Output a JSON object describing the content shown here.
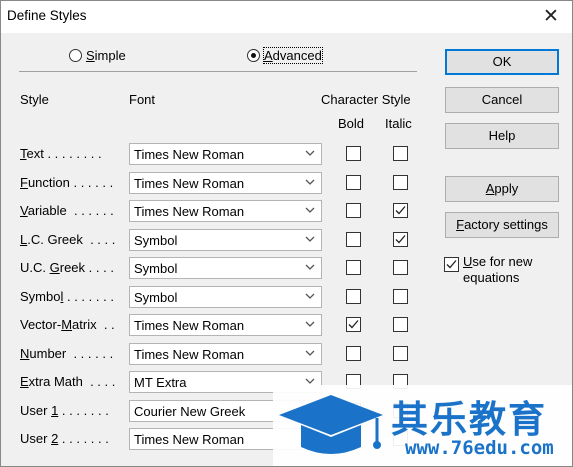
{
  "window": {
    "title": "Define Styles",
    "close_glyph": "✕"
  },
  "mode": {
    "simple_prefix": "",
    "simple_ul": "S",
    "simple_rest": "imple",
    "advanced_prefix": "",
    "advanced_ul": "A",
    "advanced_rest": "dvanced",
    "selected": "Advanced"
  },
  "headers": {
    "style": "Style",
    "font": "Font",
    "character_style": "Character Style",
    "bold": "Bold",
    "italic": "Italic"
  },
  "rows": [
    {
      "pre": "",
      "ul": "T",
      "post": "ext . . . . . . . .",
      "font": "Times New Roman",
      "bold": false,
      "italic": false
    },
    {
      "pre": "",
      "ul": "F",
      "post": "unction . . . . . .",
      "font": "Times New Roman",
      "bold": false,
      "italic": false
    },
    {
      "pre": "",
      "ul": "V",
      "post": "ariable  . . . . . .",
      "font": "Times New Roman",
      "bold": false,
      "italic": true
    },
    {
      "pre": "",
      "ul": "L",
      "post": ".C. Greek  . . . .",
      "font": "Symbol",
      "bold": false,
      "italic": true
    },
    {
      "pre": "U.C. ",
      "ul": "G",
      "post": "reek . . . .",
      "font": "Symbol",
      "bold": false,
      "italic": false
    },
    {
      "pre": "Symbo",
      "ul": "l",
      "post": " . . . . . . .",
      "font": "Symbol",
      "bold": false,
      "italic": false
    },
    {
      "pre": "Vector-",
      "ul": "M",
      "post": "atrix  . .",
      "font": "Times New Roman",
      "bold": true,
      "italic": false
    },
    {
      "pre": "",
      "ul": "N",
      "post": "umber  . . . . . .",
      "font": "Times New Roman",
      "bold": false,
      "italic": false
    },
    {
      "pre": "",
      "ul": "E",
      "post": "xtra Math  . . . .",
      "font": "MT Extra",
      "bold": false,
      "italic": false
    },
    {
      "pre": "User ",
      "ul": "1",
      "post": " . . . . . . .",
      "font": "Courier New Greek",
      "bold": false,
      "italic": false
    },
    {
      "pre": "User ",
      "ul": "2",
      "post": " . . . . . . .",
      "font": "Times New Roman",
      "bold": false,
      "italic": false
    }
  ],
  "buttons": {
    "ok": "OK",
    "cancel": "Cancel",
    "help": "Help",
    "apply_ul": "A",
    "apply_rest": "pply",
    "factory_ul": "F",
    "factory_rest": "actory settings"
  },
  "use_for_new": {
    "ul": "U",
    "rest": "se for new",
    "line2": "equations",
    "checked": true
  },
  "watermark": {
    "cn": "其乐教育",
    "url": "www.76edu.com"
  },
  "colors": {
    "accent": "#0078d7",
    "watermark": "#1a73c8"
  }
}
